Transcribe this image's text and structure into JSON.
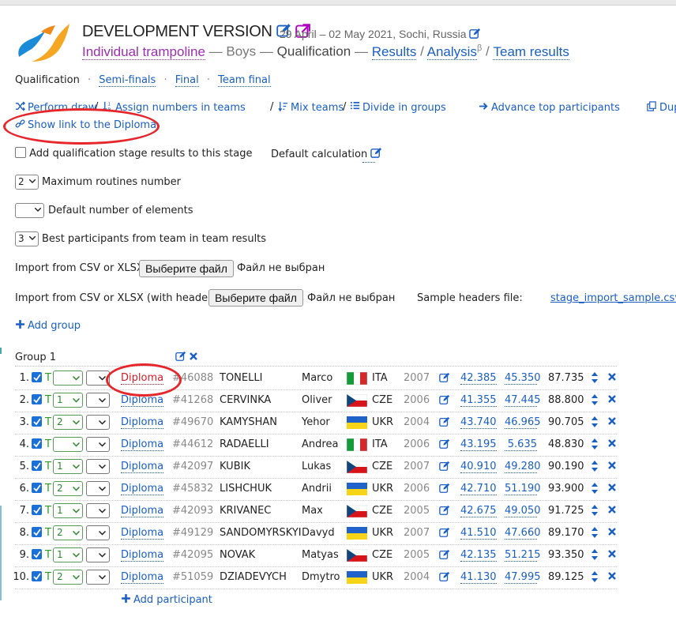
{
  "header": {
    "title": "DEVELOPMENT VERSION",
    "dates": "29 April – 02 May 2021, Sochi, Russia",
    "discipline": "Individual trampoline",
    "separator1": "—",
    "category": "Boys",
    "separator2": "—",
    "stage": "Qualification",
    "results": "Results",
    "slash1": "/",
    "analysis": "Analysis",
    "analysis_sup": "β",
    "slash2": "/",
    "team_results": "Team results"
  },
  "stages": {
    "current": "Qualification",
    "items": [
      "Semi-finals",
      "Final",
      "Team final"
    ],
    "sep": "·"
  },
  "toolbar": {
    "perform_draw": "Perform draw",
    "slash_a": "/",
    "assign_numbers": "Assign numbers in teams",
    "slash_b": "/",
    "mix_teams": "Mix teams",
    "slash_c": "/",
    "divide_groups": "Divide in groups",
    "advance_top": "Advance top participants",
    "duplicate": "Dup",
    "show_link": "Show link to the Diploma"
  },
  "options": {
    "add_qual_label": "Add qualification stage results to this stage",
    "default_calc_label": "Default calculation",
    "max_routines_value": "2",
    "max_routines_label": "Maximum routines number",
    "default_elements_value": "",
    "default_elements_label": "Default number of elements",
    "best_participants_value": "3",
    "best_participants_label": "Best participants from team in team results"
  },
  "import": {
    "csv_label": "Import from CSV or XLSX:",
    "csv_button": "Выберите файл",
    "csv_status": "Файл не выбран",
    "csv_headers_label": "Import from CSV or XLSX (with headers):",
    "csv_headers_button": "Выберите файл",
    "csv_headers_status": "Файл не выбран",
    "sample_label": "Sample headers file:",
    "sample_link": "stage_import_sample.csv"
  },
  "add_group": "Add group",
  "group": {
    "name": "Group 1",
    "add_participant": "Add participant",
    "rows": [
      {
        "n": "1.",
        "t": "T",
        "g": "",
        "diploma": "Diploma",
        "id": "#46088",
        "surname": "TONELLI",
        "first": "Marco",
        "flag": "ITA",
        "country": "ITA",
        "year": "2007",
        "s1": "42.385",
        "s2": "45.350",
        "total": "87.735"
      },
      {
        "n": "2.",
        "t": "T",
        "g": "1",
        "diploma": "Diploma",
        "id": "#41268",
        "surname": "CERVINKA",
        "first": "Oliver",
        "flag": "CZE",
        "country": "CZE",
        "year": "2006",
        "s1": "41.355",
        "s2": "47.445",
        "total": "88.800"
      },
      {
        "n": "3.",
        "t": "T",
        "g": "2",
        "diploma": "Diploma",
        "id": "#49670",
        "surname": "KAMYSHAN",
        "first": "Yehor",
        "flag": "UKR",
        "country": "UKR",
        "year": "2004",
        "s1": "43.740",
        "s2": "46.965",
        "total": "90.705"
      },
      {
        "n": "4.",
        "t": "T",
        "g": "",
        "diploma": "Diploma",
        "id": "#44612",
        "surname": "RADAELLI",
        "first": "Andrea",
        "flag": "ITA",
        "country": "ITA",
        "year": "2006",
        "s1": "43.195",
        "s2": "5.635",
        "total": "48.830"
      },
      {
        "n": "5.",
        "t": "T",
        "g": "1",
        "diploma": "Diploma",
        "id": "#42097",
        "surname": "KUBIK",
        "first": "Lukas",
        "flag": "CZE",
        "country": "CZE",
        "year": "2007",
        "s1": "40.910",
        "s2": "49.280",
        "total": "90.190"
      },
      {
        "n": "6.",
        "t": "T",
        "g": "2",
        "diploma": "Diploma",
        "id": "#45832",
        "surname": "LISHCHUK",
        "first": "Andrii",
        "flag": "UKR",
        "country": "UKR",
        "year": "2006",
        "s1": "42.710",
        "s2": "51.190",
        "total": "93.900"
      },
      {
        "n": "7.",
        "t": "T",
        "g": "1",
        "diploma": "Diploma",
        "id": "#42093",
        "surname": "KRIVANEC",
        "first": "Max",
        "flag": "CZE",
        "country": "CZE",
        "year": "2005",
        "s1": "42.675",
        "s2": "49.050",
        "total": "91.725"
      },
      {
        "n": "8.",
        "t": "T",
        "g": "2",
        "diploma": "Diploma",
        "id": "#49129",
        "surname": "SANDOMYRSKYI",
        "first": "Davyd",
        "flag": "UKR",
        "country": "UKR",
        "year": "2007",
        "s1": "41.510",
        "s2": "47.660",
        "total": "89.170"
      },
      {
        "n": "9.",
        "t": "T",
        "g": "1",
        "diploma": "Diploma",
        "id": "#42095",
        "surname": "NOVAK",
        "first": "Matyas",
        "flag": "CZE",
        "country": "CZE",
        "year": "2005",
        "s1": "42.135",
        "s2": "51.215",
        "total": "93.350"
      },
      {
        "n": "10.",
        "t": "T",
        "g": "2",
        "diploma": "Diploma",
        "id": "#51059",
        "surname": "DZIADEVYCH",
        "first": "Dmytro",
        "flag": "UKR",
        "country": "UKR",
        "year": "2004",
        "s1": "41.130",
        "s2": "47.995",
        "total": "89.125"
      }
    ]
  },
  "colors": {
    "link": "#1a5fc4",
    "accent_purple": "#9b2fb0",
    "annotation_red": "#e6262b",
    "green": "#2a9b2a"
  }
}
